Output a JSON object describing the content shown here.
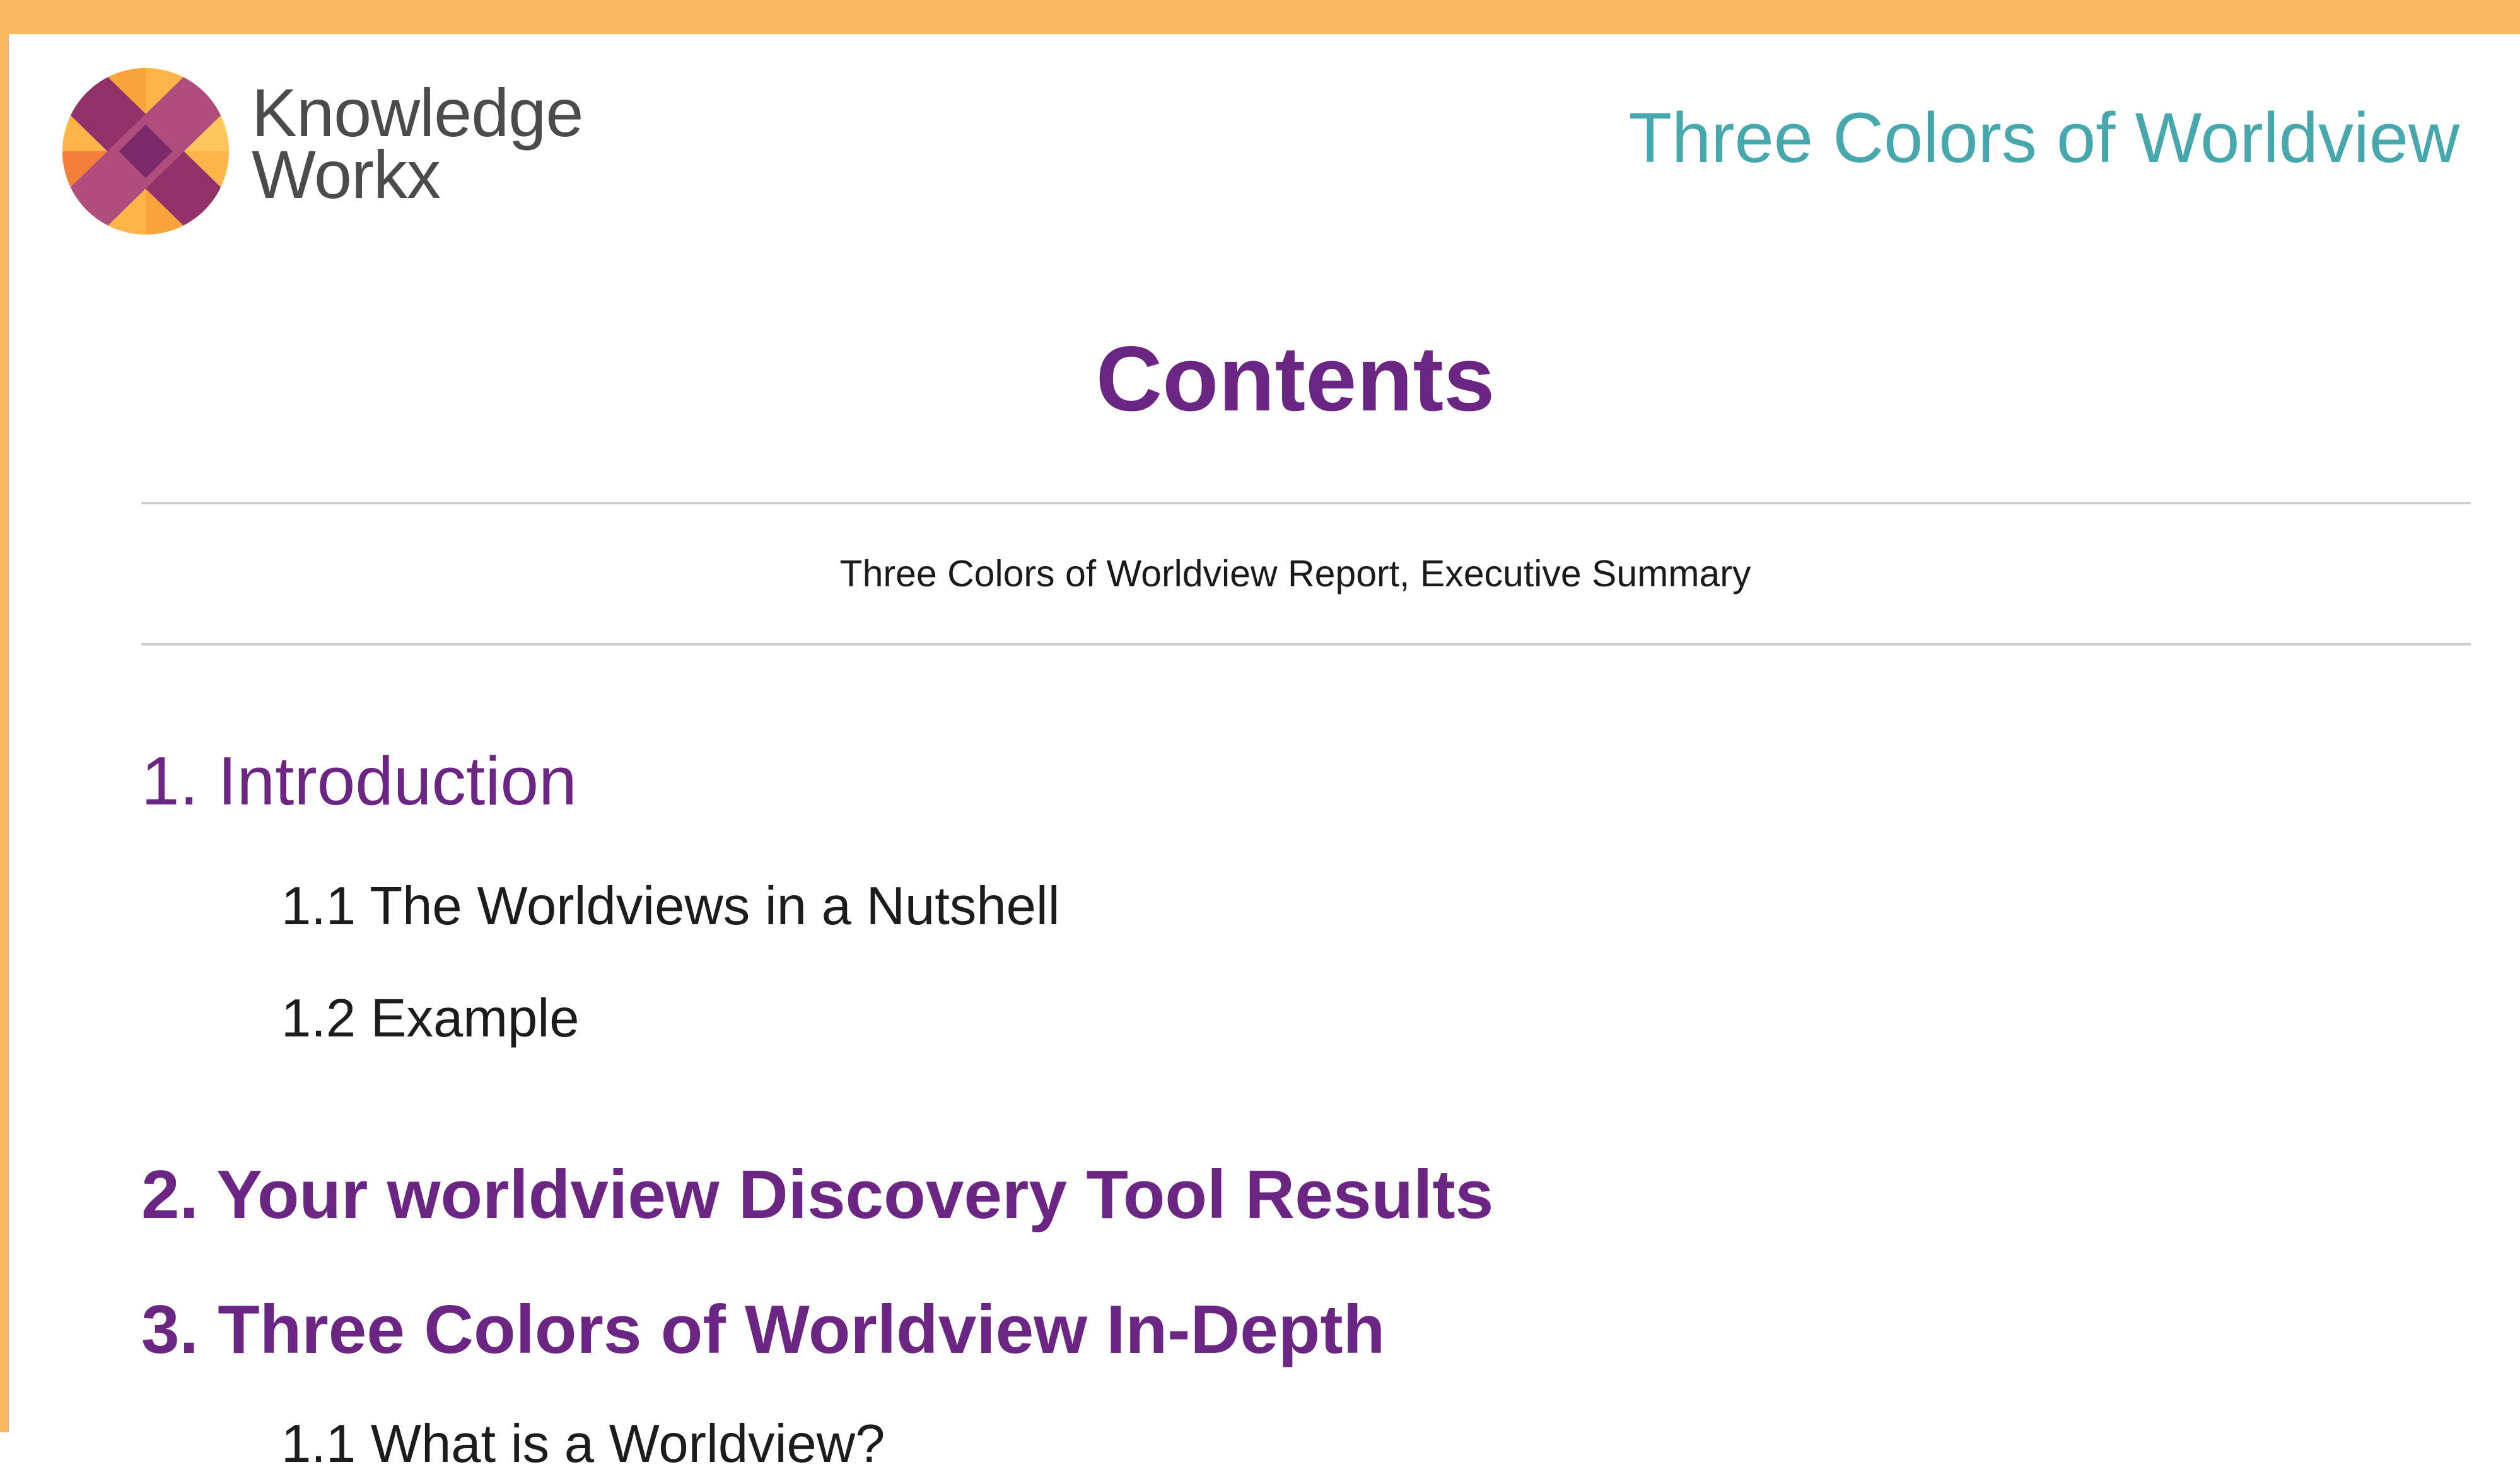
{
  "brand": {
    "line1": "Knowledge",
    "line2": "Workx"
  },
  "header": {
    "title": "Three Colors of Worldview"
  },
  "contents": {
    "title": "Contents",
    "subtitle": "Three Colors of Worldview Report, Executive Summary"
  },
  "toc": [
    {
      "label": "1. Introduction"
    },
    {
      "label": "1.1 The Worldviews in a Nutshell"
    },
    {
      "label": "1.2 Example"
    },
    {
      "label": "2. Your worldview Discovery Tool Results"
    },
    {
      "label": "3. Three Colors of Worldview In-Depth"
    },
    {
      "label": "1.1 What is a Worldview?"
    }
  ],
  "colors": {
    "frame": "#f9b75f",
    "heading_purple": "#6b2583",
    "header_teal": "#46a8ad",
    "rule_gray": "#cfcfcf"
  }
}
